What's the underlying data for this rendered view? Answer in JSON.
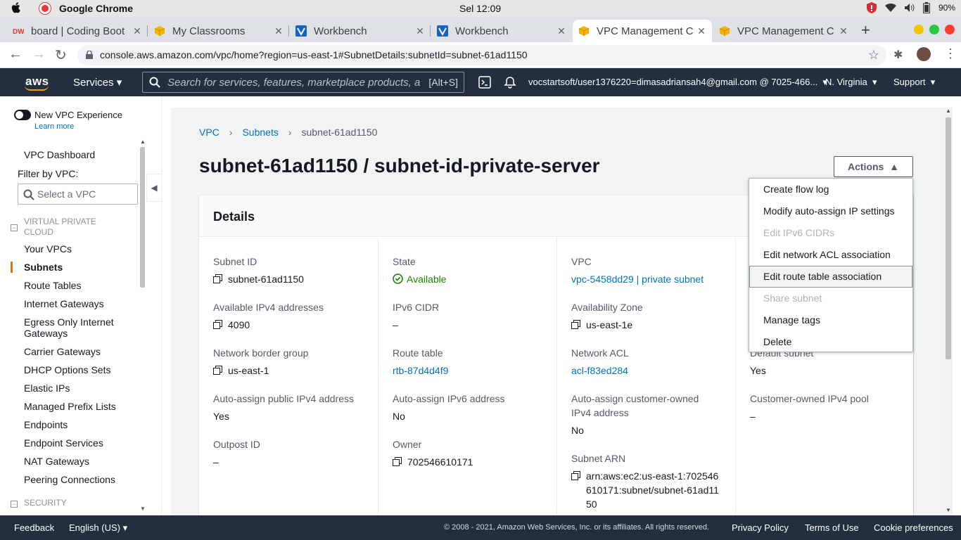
{
  "os": {
    "app_name": "Google Chrome",
    "clock": "Sel 12:09",
    "battery": "90%"
  },
  "browser": {
    "tabs": [
      {
        "title": "board | Coding Boot",
        "favicon": "coding-bootcamp-icon"
      },
      {
        "title": "My Classrooms",
        "favicon": "aws-cube-icon"
      },
      {
        "title": "Workbench",
        "favicon": "vocareum-icon"
      },
      {
        "title": "Workbench",
        "favicon": "vocareum-icon"
      },
      {
        "title": "VPC Management C",
        "favicon": "aws-cube-icon"
      },
      {
        "title": "VPC Management C",
        "favicon": "aws-cube-icon"
      }
    ],
    "url": "console.aws.amazon.com/vpc/home?region=us-east-1#SubnetDetails:subnetId=subnet-61ad1150"
  },
  "awsnav": {
    "logo": "aws",
    "services": "Services",
    "search_placeholder": "Search for services, features, marketplace products, and docs",
    "search_shortcut": "[Alt+S]",
    "account": "vocstartsoft/user1376220=dimasadriansah4@gmail.com @ 7025-466...",
    "region": "N. Virginia",
    "support": "Support"
  },
  "sidebar": {
    "new_vpc": "New VPC Experience",
    "learn_more": "Learn more",
    "dashboard": "VPC Dashboard",
    "filter_label": "Filter by VPC:",
    "filter_placeholder": "Select a VPC",
    "section_vpc": "VIRTUAL PRIVATE CLOUD",
    "items": [
      "Your VPCs",
      "Subnets",
      "Route Tables",
      "Internet Gateways",
      "Egress Only Internet Gateways",
      "Carrier Gateways",
      "DHCP Options Sets",
      "Elastic IPs",
      "Managed Prefix Lists",
      "Endpoints",
      "Endpoint Services",
      "NAT Gateways",
      "Peering Connections"
    ],
    "section_security": "SECURITY"
  },
  "breadcrumb": {
    "vpc": "VPC",
    "subnets": "Subnets",
    "current": "subnet-61ad1150"
  },
  "page": {
    "title": "subnet-61ad1150 / subnet-id-private-server",
    "actions": "Actions"
  },
  "details": {
    "heading": "Details",
    "col1": [
      {
        "k": "Subnet ID",
        "v": "subnet-61ad1150"
      },
      {
        "k": "Available IPv4 addresses",
        "v": "4090"
      },
      {
        "k": "Network border group",
        "v": "us-east-1"
      },
      {
        "k": "Auto-assign public IPv4 address",
        "v": "Yes"
      },
      {
        "k": "Outpost ID",
        "v": "–"
      }
    ],
    "col2": [
      {
        "k": "State",
        "v": "Available"
      },
      {
        "k": "IPv6 CIDR",
        "v": "–"
      },
      {
        "k": "Route table",
        "v": "rtb-87d4d4f9"
      },
      {
        "k": "Auto-assign IPv6 address",
        "v": "No"
      },
      {
        "k": "Owner",
        "v": "702546610171"
      }
    ],
    "col3": [
      {
        "k": "VPC",
        "v": "vpc-5458dd29 | private subnet"
      },
      {
        "k": "Availability Zone",
        "v": "us-east-1e"
      },
      {
        "k": "Network ACL",
        "v": "acl-f83ed284"
      },
      {
        "k": "Auto-assign customer-owned IPv4 address",
        "v": "No"
      },
      {
        "k": "Subnet ARN",
        "v": "arn:aws:ec2:us-east-1:702546610171:subnet/subnet-61ad1150"
      }
    ],
    "col4": [
      {
        "k": "Default subnet",
        "v": "Yes"
      },
      {
        "k": "Customer-owned IPv4 pool",
        "v": "–"
      }
    ]
  },
  "actions_menu": [
    {
      "label": "Create flow log",
      "disabled": false
    },
    {
      "label": "Modify auto-assign IP settings",
      "disabled": false
    },
    {
      "label": "Edit IPv6 CIDRs",
      "disabled": true
    },
    {
      "label": "Edit network ACL association",
      "disabled": false
    },
    {
      "label": "Edit route table association",
      "disabled": false,
      "highlighted": true
    },
    {
      "label": "Share subnet",
      "disabled": true
    },
    {
      "label": "Manage tags",
      "disabled": false
    },
    {
      "label": "Delete",
      "disabled": false
    }
  ],
  "footer": {
    "feedback": "Feedback",
    "language": "English (US)",
    "copyright": "© 2008 - 2021, Amazon Web Services, Inc. or its affiliates. All rights reserved.",
    "privacy": "Privacy Policy",
    "terms": "Terms of Use",
    "cookies": "Cookie preferences"
  },
  "colors": {
    "aws_nav": "#232f3e",
    "accent_orange": "#ff9900",
    "link_blue": "#0073bb",
    "success_green": "#1d8102"
  }
}
